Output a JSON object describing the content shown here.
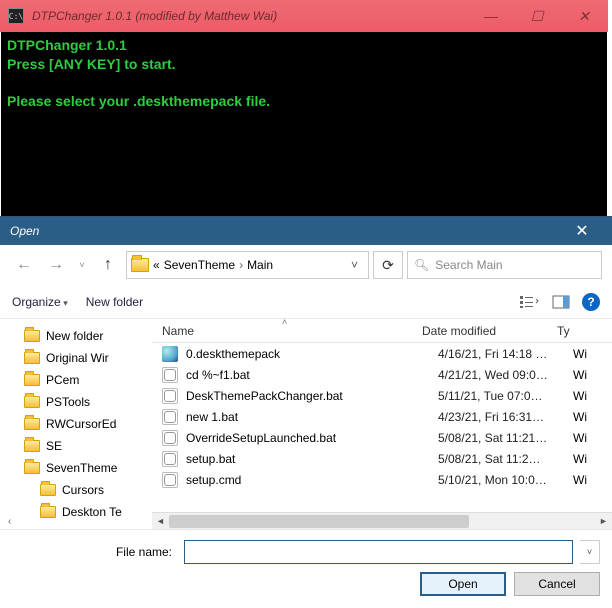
{
  "console": {
    "title": "DTPChanger 1.0.1 (modified by Matthew Wai)",
    "line1": "DTPChanger 1.0.1",
    "line2": "Press [ANY KEY] to start.",
    "line3": "Please select your .deskthemepack file."
  },
  "dialog": {
    "title": "Open",
    "path_prefix": "«",
    "path1": "SevenTheme",
    "path2": "Main",
    "search_placeholder": "Search Main",
    "organize": "Organize",
    "new_folder": "New folder",
    "columns": {
      "name": "Name",
      "date": "Date modified",
      "type": "Ty"
    },
    "filename_label": "File name:",
    "filename_value": "",
    "open": "Open",
    "cancel": "Cancel"
  },
  "tree": [
    {
      "label": "New folder",
      "sub": false
    },
    {
      "label": "Original Wir",
      "sub": false
    },
    {
      "label": "PCem",
      "sub": false
    },
    {
      "label": "PSTools",
      "sub": false
    },
    {
      "label": "RWCursorEd",
      "sub": false
    },
    {
      "label": "SE",
      "sub": false
    },
    {
      "label": "SevenTheme",
      "sub": false,
      "current": true
    },
    {
      "label": "Cursors",
      "sub": true
    },
    {
      "label": "Deskton Te",
      "sub": true
    }
  ],
  "files": [
    {
      "icon": "theme",
      "name": "0.deskthemepack",
      "date": "4/16/21, Fri 14:18 …",
      "type": "Wi"
    },
    {
      "icon": "bat",
      "name": "cd %~f1.bat",
      "date": "4/21/21, Wed 09:0…",
      "type": "Wi"
    },
    {
      "icon": "bat",
      "name": "DeskThemePackChanger.bat",
      "date": "5/11/21, Tue 07:0…",
      "type": "Wi"
    },
    {
      "icon": "bat",
      "name": "new 1.bat",
      "date": "4/23/21, Fri 16:31…",
      "type": "Wi"
    },
    {
      "icon": "bat",
      "name": "OverrideSetupLaunched.bat",
      "date": "5/08/21, Sat 11:21…",
      "type": "Wi"
    },
    {
      "icon": "bat",
      "name": "setup.bat",
      "date": "5/08/21, Sat 11:2…",
      "type": "Wi"
    },
    {
      "icon": "bat",
      "name": "setup.cmd",
      "date": "5/10/21, Mon 10:0…",
      "type": "Wi"
    }
  ]
}
